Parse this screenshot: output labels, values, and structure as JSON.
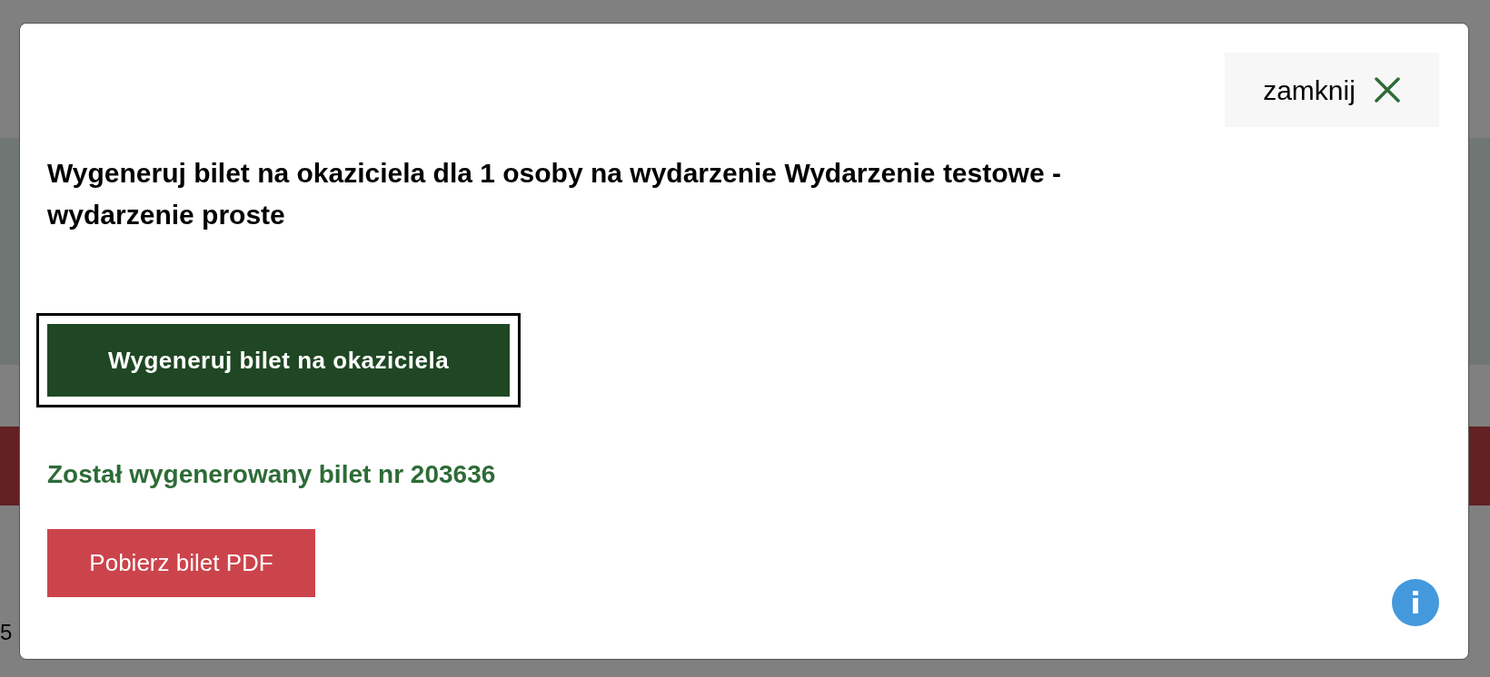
{
  "background": {
    "left_small_text": "5"
  },
  "dialog": {
    "close_button": {
      "label": "zamknij"
    },
    "heading": "Wygeneruj bilet na okaziciela dla 1 osoby na wydarzenie Wydarzenie testowe - wydarzenie proste",
    "generate_button": {
      "label": "Wygeneruj bilet na okaziciela",
      "focused": true
    },
    "success_message": "Został wygenerowany bilet nr 203636",
    "download_button": {
      "label": "Pobierz bilet PDF"
    }
  }
}
